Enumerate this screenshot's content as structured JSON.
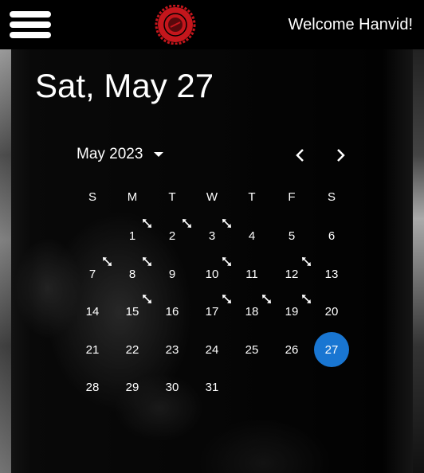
{
  "header": {
    "menu_icon": "hamburger-menu-icon",
    "logo_icon": "red-seal-logo",
    "welcome": "Welcome Hanvid!"
  },
  "picker": {
    "title": "Sat, May 27",
    "month_label": "May 2023",
    "prev_icon": "chevron-left-icon",
    "next_icon": "chevron-right-icon",
    "weekdays": [
      "S",
      "M",
      "T",
      "W",
      "T",
      "F",
      "S"
    ],
    "days": [
      "1",
      "2",
      "3",
      "4",
      "5",
      "6",
      "7",
      "8",
      "9",
      "10",
      "11",
      "12",
      "13",
      "14",
      "15",
      "16",
      "17",
      "18",
      "19",
      "20",
      "21",
      "22",
      "23",
      "24",
      "25",
      "26",
      "27",
      "28",
      "29",
      "30",
      "31"
    ],
    "selected_day": "27",
    "first_weekday_index": 1,
    "marked_days": [
      1,
      2,
      3,
      7,
      8,
      10,
      12,
      15,
      17,
      18,
      19
    ],
    "marker_icon": "diagonal-arrow-icon",
    "selected_color": "#1976d2"
  }
}
